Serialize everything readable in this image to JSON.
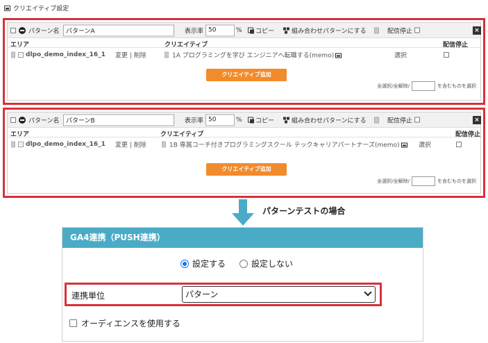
{
  "section_title": "クリエイティブ設定",
  "patterns": [
    {
      "name_label": "パターン名",
      "name_value": "パターンA",
      "rate_label": "表示率",
      "rate_value": "50",
      "rate_unit": "%",
      "copy_label": "コピー",
      "combo_label": "組み合わせパターンにする",
      "stop_label": "配信停止",
      "close_label": "×",
      "col_area": "エリア",
      "col_creative": "クリエイティブ",
      "col_stop": "配信停止",
      "row_area": "dlpo_demo_index_16_1",
      "row_links": "変更 | 削除",
      "row_creative": "1A プログラミングを学び エンジニアへ転職する(memo)",
      "row_select": "選択",
      "add_button": "クリエイティブ追加",
      "select_all_prefix": "全選択/全解除/",
      "select_all_suffix": "を含むものを選択"
    },
    {
      "name_label": "パターン名",
      "name_value": "パターンB",
      "rate_label": "表示率",
      "rate_value": "50",
      "rate_unit": "%",
      "copy_label": "コピー",
      "combo_label": "組み合わせパターンにする",
      "stop_label": "配信停止",
      "close_label": "×",
      "col_area": "エリア",
      "col_creative": "クリエイティブ",
      "col_stop": "配信停止",
      "row_area": "dlpo_demo_index_16_1",
      "row_links": "変更 | 削除",
      "row_creative": "1B 専属コーチ付きプログラミングスクール テックキャリアパートナーズ(memo)",
      "row_select": "選択",
      "add_button": "クリエイティブ追加",
      "select_all_prefix": "全選択/全解除/",
      "select_all_suffix": "を含むものを選択"
    }
  ],
  "arrow_caption": "パターンテストの場合",
  "ga4": {
    "header": "GA4連携（PUSH連携）",
    "radio_on": "設定する",
    "radio_off": "設定しない",
    "unit_label": "連携単位",
    "unit_value": "パターン",
    "audience_label": "オーディエンスを使用する"
  },
  "colors": {
    "highlight_border": "#d9303a",
    "header_bg": "#4aabc7",
    "add_button_bg": "#f28b2c",
    "arrow": "#4aabc7"
  }
}
